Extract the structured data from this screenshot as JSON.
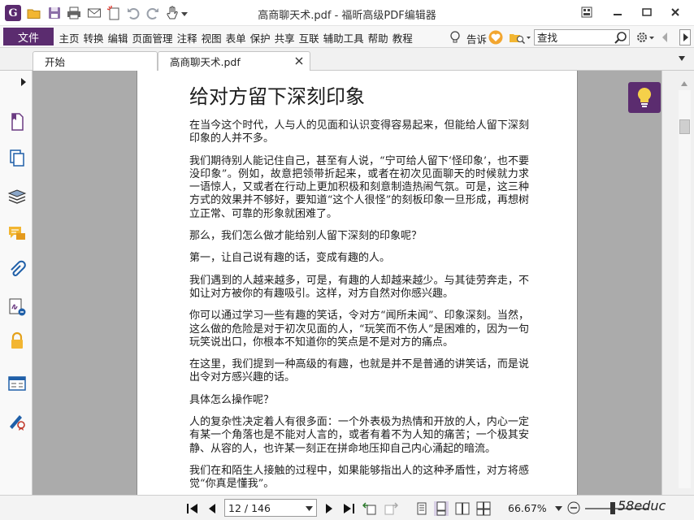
{
  "app": {
    "window_title": "高商聊天术.pdf - 福昕高级PDF编辑器",
    "logo_letter": "G"
  },
  "menubar": {
    "file_label": "文件",
    "items": [
      "主页",
      "转换",
      "编辑",
      "页面管理",
      "注释",
      "视图",
      "表单",
      "保护",
      "共享",
      "互联",
      "辅助工具",
      "帮助",
      "教程"
    ],
    "tell_me_label": "告诉",
    "search_placeholder": "查找"
  },
  "tabs": [
    {
      "label": "开始"
    },
    {
      "label": "高商聊天术.pdf"
    }
  ],
  "document": {
    "heading": "给对方留下深刻印象",
    "paragraphs": [
      "在当今这个时代，人与人的见面和认识变得容易起来，但能给人留下深刻印象的人并不多。",
      "我们期待别人能记住自己，甚至有人说，“宁可给人留下‘怪印象’，也不要没印象”。例如，故意把领带折起来，或者在初次见面聊天的时候就力求一语惊人，又或者在行动上更加积极和刻意制造热闹气氛。可是，这三种方式的效果并不够好，要知道“这个人很怪”的刻板印象一旦形成，再想树立正常、可靠的形象就困难了。",
      "那么，我们怎么做才能给别人留下深刻的印象呢？",
      "第一，让自己说有趣的话，变成有趣的人。",
      "我们遇到的人越来越多，可是，有趣的人却越来越少。与其徒劳奔走，不如让对方被你的有趣吸引。这样，对方自然对你感兴趣。",
      "你可以通过学习一些有趣的笑话，令对方“闻所未闻”、印象深刻。当然，这么做的危险是对于初次见面的人，“玩笑而不伤人”是困难的，因为一句玩笑说出口，你根本不知道你的笑点是不是对方的痛点。",
      "在这里，我们提到一种高级的有趣，也就是并不是普通的讲笑话，而是说出令对方感兴趣的话。",
      "具体怎么操作呢？",
      "人的复杂性决定着人有很多面：一个外表极为热情和开放的人，内心一定有某一个角落也是不能对人言的，或者有着不为人知的痛苦；一个极其安静、从容的人，也许某一刻正在拼命地压抑自己内心涌起的暗流。",
      "我们在和陌生人接触的过程中，如果能够指出人的这种矛盾性，对方将感觉“你真是懂我”。"
    ]
  },
  "statusbar": {
    "page_value": "12 / 146",
    "zoom_label": "66.67%",
    "watermark": "58educ"
  },
  "colors": {
    "brand_purple": "#5b2c6f",
    "canvas_gray": "#ababab"
  }
}
